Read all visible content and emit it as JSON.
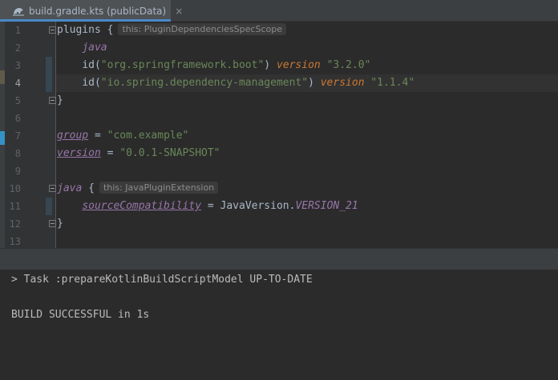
{
  "tab": {
    "title": "build.gradle.kts (publicData)",
    "close_glyph": "×",
    "icon": "gradle-kotlin-file-icon"
  },
  "editor": {
    "line_numbers": [
      "1",
      "2",
      "3",
      "4",
      "5",
      "6",
      "7",
      "8",
      "9",
      "10",
      "11",
      "12",
      "13"
    ],
    "current_line": "4",
    "lines": {
      "l1": {
        "a": "plugins {",
        "hint": "this: PluginDependenciesSpecScope"
      },
      "l2": {
        "ext": "java"
      },
      "l3": {
        "a": "id(",
        "str": "\"org.springframework.boot\"",
        "b": ") ",
        "kw": "version",
        "c": " ",
        "str2": "\"3.2.0\""
      },
      "l4": {
        "a": "id(",
        "str": "\"io.spring.dependency-management\"",
        "b": ") ",
        "kw": "version",
        "c": " ",
        "str2": "\"1.1.4\""
      },
      "l5": {
        "a": "}"
      },
      "l7": {
        "prop": "group",
        "b": " = ",
        "str": "\"com.example\""
      },
      "l8": {
        "prop": "version",
        "b": " = ",
        "str": "\"0.0.1-SNAPSHOT\""
      },
      "l10": {
        "ext": "java",
        "a": " {",
        "hint": "this: JavaPluginExtension"
      },
      "l11": {
        "prop": "sourceCompatibility",
        "b": " = JavaVersion.",
        "const": "VERSION_21"
      },
      "l12": {
        "a": "}"
      }
    }
  },
  "console": {
    "task_line": "> Task :prepareKotlinBuildScriptModel UP-TO-DATE",
    "result_line": "BUILD SUCCESSFUL in 1s"
  },
  "colors": {
    "background": "#2b2b2b",
    "keyword": "#cc7832",
    "string": "#6a8759",
    "property": "#9876aa",
    "tab_underline": "#4a88c7"
  }
}
